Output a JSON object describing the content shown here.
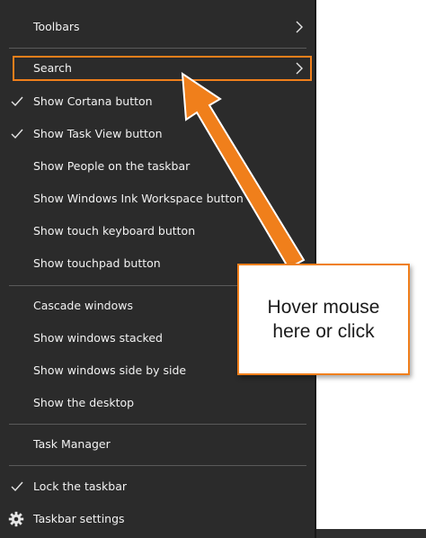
{
  "menu": {
    "items": [
      {
        "label": "Toolbars",
        "checked": false,
        "submenu": true
      },
      {
        "label": "Search",
        "checked": false,
        "submenu": true
      },
      {
        "label": "Show Cortana button",
        "checked": true,
        "submenu": false
      },
      {
        "label": "Show Task View button",
        "checked": true,
        "submenu": false
      },
      {
        "label": "Show People on the taskbar",
        "checked": false,
        "submenu": false
      },
      {
        "label": "Show Windows Ink Workspace button",
        "checked": false,
        "submenu": false
      },
      {
        "label": "Show touch keyboard button",
        "checked": false,
        "submenu": false
      },
      {
        "label": "Show touchpad button",
        "checked": false,
        "submenu": false
      },
      {
        "label": "Cascade windows",
        "checked": false,
        "submenu": false
      },
      {
        "label": "Show windows stacked",
        "checked": false,
        "submenu": false
      },
      {
        "label": "Show windows side by side",
        "checked": false,
        "submenu": false
      },
      {
        "label": "Show the desktop",
        "checked": false,
        "submenu": false
      },
      {
        "label": "Task Manager",
        "checked": false,
        "submenu": false
      },
      {
        "label": "Lock the taskbar",
        "checked": true,
        "submenu": false
      },
      {
        "label": "Taskbar settings",
        "checked": false,
        "submenu": false,
        "icon": "gear-icon"
      }
    ]
  },
  "callout": {
    "text": "Hover mouse\nhere or click"
  },
  "colors": {
    "menu_background": "#2b2b2b",
    "menu_text": "#f2f2f2",
    "separator": "#5a5a5a",
    "accent_orange": "#f07f1b"
  }
}
